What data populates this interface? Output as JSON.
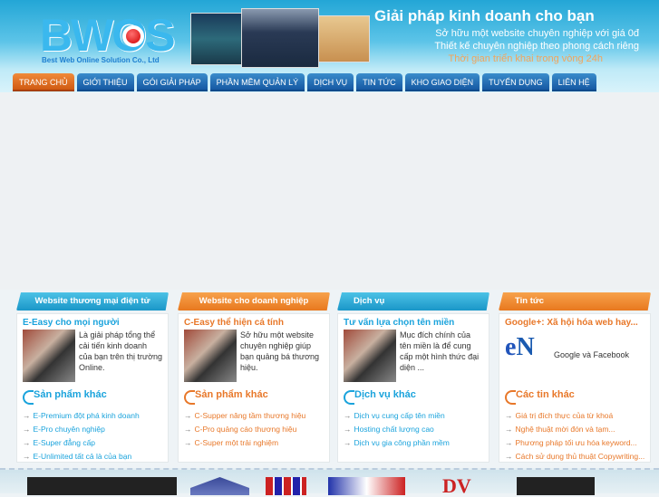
{
  "header": {
    "logo": "BWOS",
    "logo_sub": "Best Web Online Solution Co., Ltd",
    "slogan": [
      "Giải pháp kinh doanh cho bạn",
      "Sở hữu một website chuyên nghiệp với giá 0đ",
      "Thiết kế chuyên nghiệp theo phong cách riêng",
      "Thời gian triển khai trong vòng 24h"
    ]
  },
  "nav": [
    {
      "label": "TRANG CHỦ",
      "active": true
    },
    {
      "label": "GIỚI THIỆU"
    },
    {
      "label": "GÓI GIẢI PHÁP"
    },
    {
      "label": "PHẦN MỀM QUẢN LÝ"
    },
    {
      "label": "DỊCH VỤ"
    },
    {
      "label": "TIN TỨC"
    },
    {
      "label": "KHO GIAO DIỆN"
    },
    {
      "label": "TUYỂN DỤNG"
    },
    {
      "label": "LIÊN HỆ"
    }
  ],
  "boxes": [
    {
      "header": "Website thương mại điện tử",
      "title": "E-Easy cho mọi người",
      "desc": "Là giải pháp tổng thể cải tiến kinh doanh của bạn trên thị trường Online.",
      "sub": "Sản phẩm khác",
      "links": [
        "E-Premium đột phá kinh doanh",
        "E-Pro chuyên nghiệp",
        "E-Super đẳng cấp",
        "E-Unlimited tất cả là của bạn"
      ]
    },
    {
      "header": "Website cho doanh nghiệp",
      "title": "C-Easy thể hiện cá tính",
      "desc": "Sở hữu một website chuyên nghiệp giúp bạn quảng bá thương hiệu.",
      "sub": "Sản phẩm khác",
      "links": [
        "C-Supper nâng tầm thương hiệu",
        "C-Pro quảng cáo thương hiệu",
        "C-Super một trải nghiệm"
      ]
    },
    {
      "header": "Dịch vụ",
      "title": "Tư vấn lựa chọn tên miền",
      "desc": "Mục đích chính của tên miền là để cung cấp một hình thức đại diện ...",
      "sub": "Dịch vụ khác",
      "links": [
        "Dịch vụ cung cấp tên miền",
        "Hosting chất lượng cao",
        "Dịch vụ gia công phần mềm"
      ]
    },
    {
      "header": "Tin tức",
      "title": "Google+: Xã hội hóa web hay...",
      "desc": "Google và Facebook",
      "sub": "Các tin khác",
      "links": [
        "Giá trị đích thực của từ khoá",
        "Nghệ thuật mời đón và tạm...",
        "Phương pháp tối ưu hóa keyword...",
        "Cách sử dụng thủ thuật Copywriting..."
      ]
    }
  ],
  "colors": {
    "blue": "#1aa3dc",
    "orange": "#e8782a",
    "nav": "#1659a3"
  }
}
